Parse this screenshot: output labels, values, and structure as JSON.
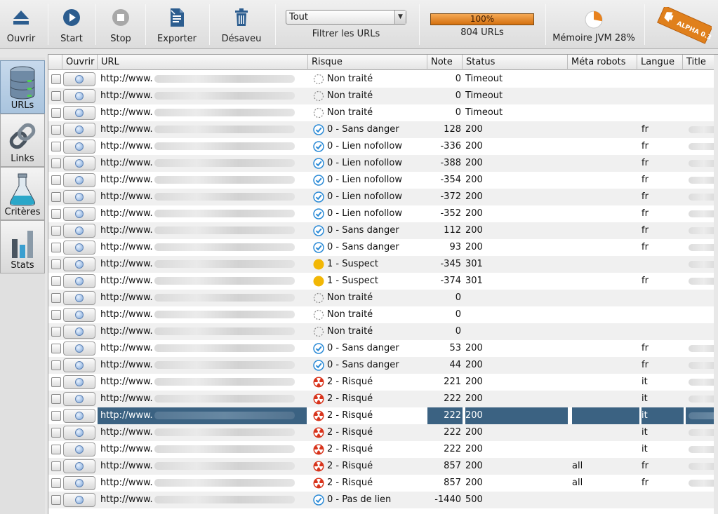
{
  "toolbar": {
    "open_label": "Ouvrir",
    "start_label": "Start",
    "stop_label": "Stop",
    "export_label": "Exporter",
    "disavow_label": "Désaveu",
    "filter_value": "Tout",
    "filter_label": "Filtrer les URLs",
    "progress_text": "100%",
    "progress_value": 100,
    "urls_count": "804 URLs",
    "memory_label": "Mémoire JVM 28%",
    "memory_value": 28,
    "badge_text": "ALPHA 0.3"
  },
  "sidenav": {
    "items": [
      {
        "label": "URLs",
        "icon": "database-icon",
        "active": true
      },
      {
        "label": "Links",
        "icon": "chain-link-icon",
        "active": false
      },
      {
        "label": "Critères",
        "icon": "flask-icon",
        "active": false
      },
      {
        "label": "Stats",
        "icon": "bar-chart-icon",
        "active": false
      }
    ]
  },
  "table": {
    "columns": [
      "Ouvrir",
      "URL",
      "Risque",
      "Note",
      "Status",
      "Méta robots",
      "Langue",
      "Title"
    ],
    "rows": [
      {
        "url": "http://www.",
        "risk": "Non traité",
        "risk_type": "none",
        "note": "0",
        "status": "Timeout",
        "meta": "",
        "lang": "",
        "title": false
      },
      {
        "url": "http://www.",
        "risk": "Non traité",
        "risk_type": "none",
        "note": "0",
        "status": "Timeout",
        "meta": "",
        "lang": "",
        "title": false
      },
      {
        "url": "http://www.",
        "risk": "Non traité",
        "risk_type": "none",
        "note": "0",
        "status": "Timeout",
        "meta": "",
        "lang": "",
        "title": false
      },
      {
        "url": "http://www.",
        "risk": "0 - Sans danger",
        "risk_type": "safe",
        "note": "128",
        "status": "200",
        "meta": "",
        "lang": "fr",
        "title": true
      },
      {
        "url": "http://www.",
        "risk": "0 - Lien nofollow",
        "risk_type": "safe",
        "note": "-336",
        "status": "200",
        "meta": "",
        "lang": "fr",
        "title": true
      },
      {
        "url": "http://www.",
        "risk": "0 - Lien nofollow",
        "risk_type": "safe",
        "note": "-388",
        "status": "200",
        "meta": "",
        "lang": "fr",
        "title": true
      },
      {
        "url": "http://www.",
        "risk": "0 - Lien nofollow",
        "risk_type": "safe",
        "note": "-354",
        "status": "200",
        "meta": "",
        "lang": "fr",
        "title": true
      },
      {
        "url": "http://www.",
        "risk": "0 - Lien nofollow",
        "risk_type": "safe",
        "note": "-372",
        "status": "200",
        "meta": "",
        "lang": "fr",
        "title": true
      },
      {
        "url": "http://www.",
        "risk": "0 - Lien nofollow",
        "risk_type": "safe",
        "note": "-352",
        "status": "200",
        "meta": "",
        "lang": "fr",
        "title": true
      },
      {
        "url": "http://www.",
        "risk": "0 - Sans danger",
        "risk_type": "safe",
        "note": "112",
        "status": "200",
        "meta": "",
        "lang": "fr",
        "title": true
      },
      {
        "url": "http://www.",
        "risk": "0 - Sans danger",
        "risk_type": "safe",
        "note": "93",
        "status": "200",
        "meta": "",
        "lang": "fr",
        "title": true
      },
      {
        "url": "http://www.",
        "risk": "1 - Suspect",
        "risk_type": "suspect",
        "note": "-345",
        "status": "301",
        "meta": "",
        "lang": "",
        "title": true
      },
      {
        "url": "http://www.",
        "risk": "1 - Suspect",
        "risk_type": "suspect",
        "note": "-374",
        "status": "301",
        "meta": "",
        "lang": "fr",
        "title": true
      },
      {
        "url": "http://www.",
        "risk": "Non traité",
        "risk_type": "none",
        "note": "0",
        "status": "",
        "meta": "",
        "lang": "",
        "title": false
      },
      {
        "url": "http://www.",
        "risk": "Non traité",
        "risk_type": "none",
        "note": "0",
        "status": "",
        "meta": "",
        "lang": "",
        "title": false
      },
      {
        "url": "http://www.",
        "risk": "Non traité",
        "risk_type": "none",
        "note": "0",
        "status": "",
        "meta": "",
        "lang": "",
        "title": false
      },
      {
        "url": "http://www.",
        "risk": "0 - Sans danger",
        "risk_type": "safe",
        "note": "53",
        "status": "200",
        "meta": "",
        "lang": "fr",
        "title": true
      },
      {
        "url": "http://www.",
        "risk": "0 - Sans danger",
        "risk_type": "safe",
        "note": "44",
        "status": "200",
        "meta": "",
        "lang": "fr",
        "title": true
      },
      {
        "url": "http://www.",
        "risk": "2 - Risqué",
        "risk_type": "risky",
        "note": "221",
        "status": "200",
        "meta": "",
        "lang": "it",
        "title": true
      },
      {
        "url": "http://www.",
        "risk": "2 - Risqué",
        "risk_type": "risky",
        "note": "222",
        "status": "200",
        "meta": "",
        "lang": "it",
        "title": true
      },
      {
        "url": "http://www.",
        "risk": "2 - Risqué",
        "risk_type": "risky",
        "note": "222",
        "status": "200",
        "meta": "",
        "lang": "it",
        "title": true,
        "selected": true
      },
      {
        "url": "http://www.",
        "risk": "2 - Risqué",
        "risk_type": "risky",
        "note": "222",
        "status": "200",
        "meta": "",
        "lang": "it",
        "title": true
      },
      {
        "url": "http://www.",
        "risk": "2 - Risqué",
        "risk_type": "risky",
        "note": "222",
        "status": "200",
        "meta": "",
        "lang": "it",
        "title": true
      },
      {
        "url": "http://www.",
        "risk": "2 - Risqué",
        "risk_type": "risky",
        "note": "857",
        "status": "200",
        "meta": "all",
        "lang": "fr",
        "title": true
      },
      {
        "url": "http://www.",
        "risk": "2 - Risqué",
        "risk_type": "risky",
        "note": "857",
        "status": "200",
        "meta": "all",
        "lang": "fr",
        "title": true
      },
      {
        "url": "http://www.",
        "risk": "0 - Pas de lien",
        "risk_type": "safe",
        "note": "-1440",
        "status": "500",
        "meta": "",
        "lang": "",
        "title": false
      }
    ]
  },
  "colors": {
    "selection": "#3b6282",
    "safe": "#2a8ad6",
    "suspect": "#f2b705",
    "risky": "#d8341c",
    "progress": "#e07f1f"
  }
}
